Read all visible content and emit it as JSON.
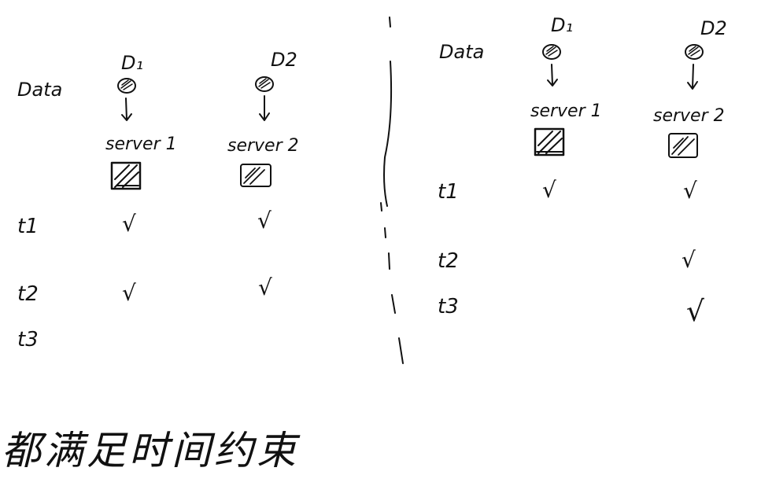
{
  "left_panel": {
    "data_label": "Data",
    "nodes": [
      {
        "id": "D1",
        "label": "D₁",
        "server_label": "server 1"
      },
      {
        "id": "D2",
        "label": "D2",
        "server_label": "server 2"
      }
    ],
    "rows": [
      {
        "label": "t1",
        "marks": [
          "√",
          "√"
        ]
      },
      {
        "label": "t2",
        "marks": [
          "√",
          "√"
        ]
      },
      {
        "label": "t3",
        "marks": [
          "",
          ""
        ]
      }
    ]
  },
  "right_panel": {
    "data_label": "Data",
    "nodes": [
      {
        "id": "D1",
        "label": "D₁",
        "server_label": "server 1"
      },
      {
        "id": "D2",
        "label": "D2",
        "server_label": "server 2"
      }
    ],
    "rows": [
      {
        "label": "t1",
        "marks": [
          "√",
          "√"
        ]
      },
      {
        "label": "t2",
        "marks": [
          "",
          "√"
        ]
      },
      {
        "label": "t3",
        "marks": [
          "",
          "√"
        ]
      }
    ]
  },
  "bottom_note": "都满足时间约束",
  "colors": {
    "ink": "#111111",
    "background": "#ffffff"
  }
}
